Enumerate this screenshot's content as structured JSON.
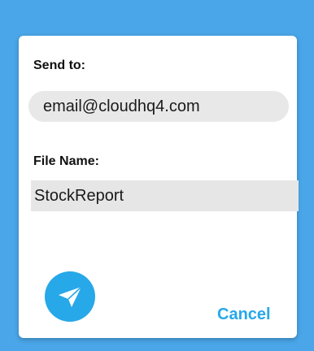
{
  "dialog": {
    "send_to_label": "Send to:",
    "email_value": "email@cloudhq4.com",
    "file_name_label": "File Name:",
    "file_name_value": "StockReport",
    "send_icon": "paper-plane-icon",
    "cancel_label": "Cancel"
  },
  "colors": {
    "backdrop": "#4aa6e8",
    "accent": "#27a8e8",
    "field_bg": "#e8e8e8"
  }
}
